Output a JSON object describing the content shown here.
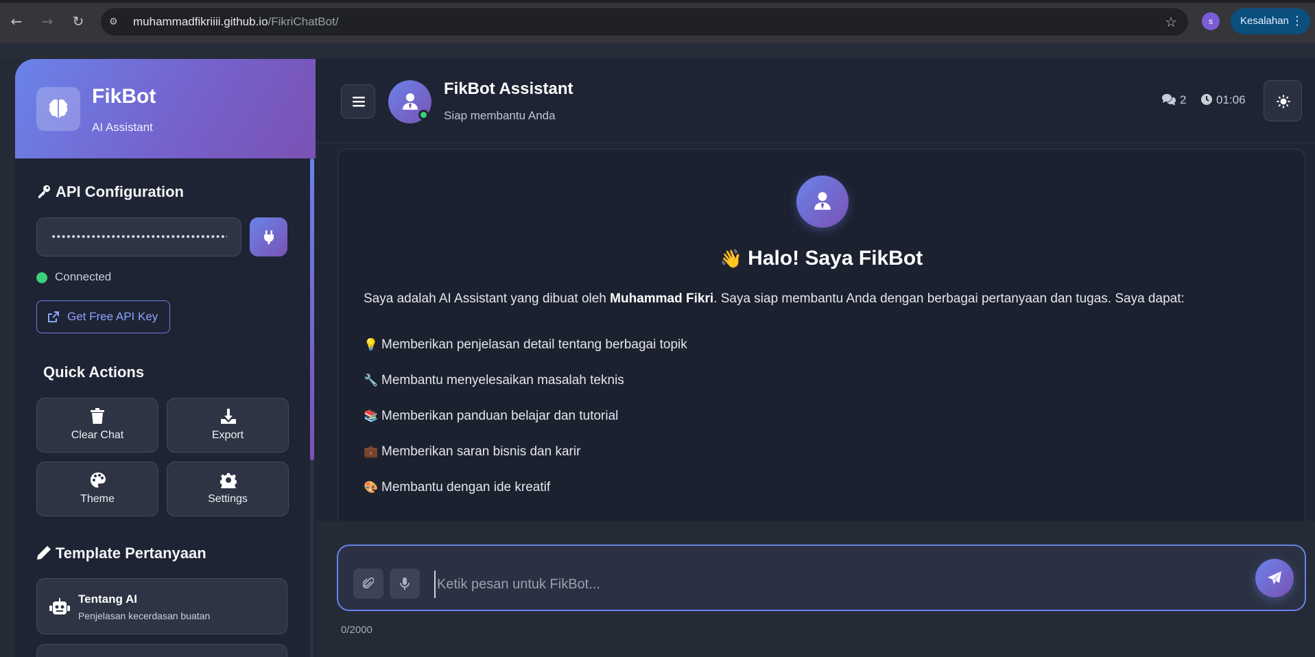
{
  "browser": {
    "url_host": "muhammadfikriiii.github.io",
    "url_path": "/FikriChatBot/",
    "profile_initial": "s",
    "error_chip": "Kesalahan"
  },
  "sidebar": {
    "brand_title": "FikBot",
    "brand_subtitle": "AI Assistant",
    "api_section_title": "API Configuration",
    "api_key_value": "••••••••••••••••••••••••••••••••••••••",
    "status_text": "Connected",
    "free_key_label": "Get Free API Key",
    "quick_actions_title": "Quick Actions",
    "quick_actions": [
      {
        "label": "Clear Chat",
        "icon": "trash-icon"
      },
      {
        "label": "Export",
        "icon": "download-icon"
      },
      {
        "label": "Theme",
        "icon": "palette-icon"
      },
      {
        "label": "Settings",
        "icon": "gear-icon"
      }
    ],
    "templates_title": "Template Pertanyaan",
    "templates": [
      {
        "title": "Tentang AI",
        "desc": "Penjelasan kecerdasan buatan",
        "icon": "robot-icon"
      }
    ]
  },
  "header": {
    "bot_name": "FikBot Assistant",
    "bot_status": "Siap membantu Anda",
    "message_count": "2",
    "timer": "01:06"
  },
  "welcome": {
    "title": "Halo! Saya FikBot",
    "title_emoji": "👋",
    "intro_before": "Saya adalah AI Assistant yang dibuat oleh ",
    "intro_name": "Muhammad Fikri",
    "intro_after": ". Saya siap membantu Anda dengan berbagai pertanyaan dan tugas. Saya dapat:",
    "capabilities": [
      {
        "emoji": "💡",
        "text": "Memberikan penjelasan detail tentang berbagai topik"
      },
      {
        "emoji": "🔧",
        "text": "Membantu menyelesaikan masalah teknis"
      },
      {
        "emoji": "📚",
        "text": "Memberikan panduan belajar dan tutorial"
      },
      {
        "emoji": "💼",
        "text": "Memberikan saran bisnis dan karir"
      },
      {
        "emoji": "🎨",
        "text": "Membantu dengan ide kreatif"
      }
    ]
  },
  "composer": {
    "placeholder": "Ketik pesan untuk FikBot...",
    "char_counter": "0/2000"
  },
  "colors": {
    "accent_start": "#6a83ea",
    "accent_end": "#7a52b4",
    "online": "#3ccf7b"
  }
}
